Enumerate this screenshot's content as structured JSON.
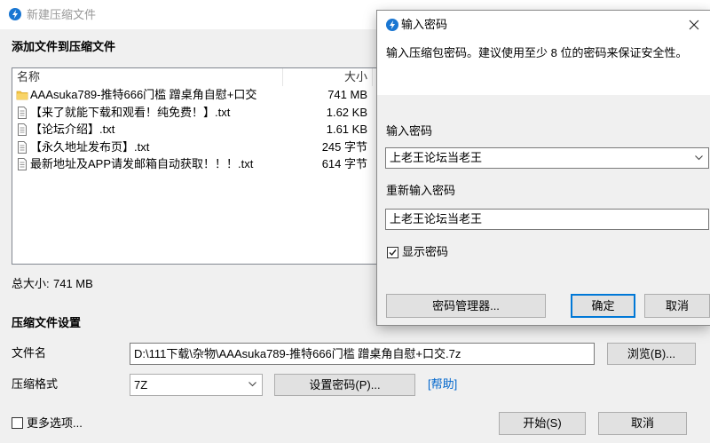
{
  "main_window": {
    "title": "新建压缩文件",
    "add_section_title": "添加文件到压缩文件",
    "file_list": {
      "columns": {
        "name": "名称",
        "size": "大小"
      },
      "rows": [
        {
          "icon": "folder-icon",
          "name": "AAAsuka789-推特666门槛 蹭桌角自慰+口交",
          "size": "741 MB"
        },
        {
          "icon": "text-file-icon",
          "name": "【来了就能下载和观看！纯免费！】.txt",
          "size": "1.62 KB"
        },
        {
          "icon": "text-file-icon",
          "name": "【论坛介绍】.txt",
          "size": "1.61 KB"
        },
        {
          "icon": "text-file-icon",
          "name": "【永久地址发布页】.txt",
          "size": "245 字节"
        },
        {
          "icon": "text-file-icon",
          "name": "最新地址及APP请发邮箱自动获取！！！.txt",
          "size": "614 字节"
        }
      ]
    },
    "total_size_label": "总大小:",
    "total_size_value": "741 MB",
    "settings_section_title": "压缩文件设置",
    "filename_label": "文件名",
    "filename_value": "D:\\111下载\\杂物\\AAAsuka789-推特666门槛 蹭桌角自慰+口交.7z",
    "browse_button": "浏览(B)...",
    "format_label": "压缩格式",
    "format_value": "7Z",
    "set_password_button": "设置密码(P)...",
    "help_link": "[帮助]",
    "more_options_label": "更多选项...",
    "more_options_checked": false,
    "start_button": "开始(S)",
    "cancel_button": "取消"
  },
  "password_dialog": {
    "title": "输入密码",
    "description": "输入压缩包密码。建议使用至少 8 位的密码来保证安全性。",
    "password_label": "输入密码",
    "password_value": "上老王论坛当老王",
    "confirm_label": "重新输入密码",
    "confirm_value": "上老王论坛当老王",
    "show_password_label": "显示密码",
    "show_password_checked": true,
    "password_manager_button": "密码管理器...",
    "ok_button": "确定",
    "cancel_button": "取消"
  },
  "colors": {
    "window_bg": "#f0f0f0",
    "title_inactive": "#999999",
    "accent": "#0078d7",
    "link": "#0066cc",
    "app_icon": "#1976d2",
    "folder": "#f4c542"
  }
}
